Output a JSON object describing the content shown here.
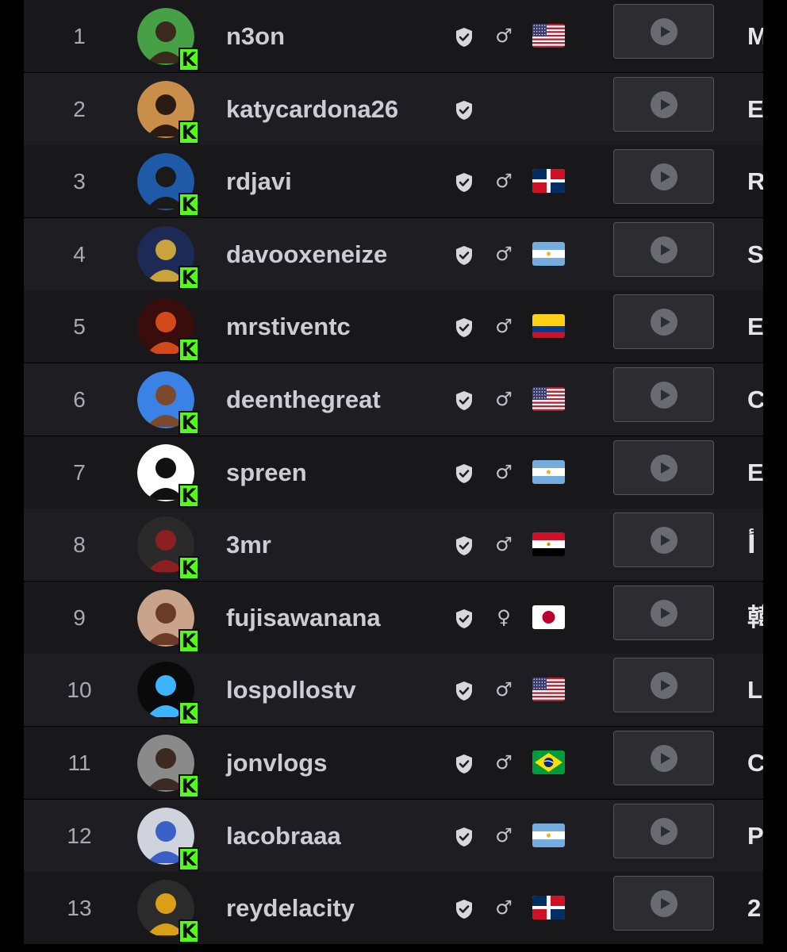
{
  "colors": {
    "kick_green": "#53fc18",
    "row_dark": "#18181b",
    "row_light": "#1e1e22",
    "text_primary": "#ccccd2",
    "text_muted": "#a9a9b0"
  },
  "icons": {
    "verified": "shield-check-icon",
    "male": "male-icon",
    "female": "female-icon",
    "play": "play-icon",
    "kick_badge": "kick-logo-icon"
  },
  "streamers": [
    {
      "rank": "1",
      "username": "n3on",
      "gender": "♂",
      "country": "US",
      "category_initial": "M"
    },
    {
      "rank": "2",
      "username": "katycardona26",
      "gender": "",
      "country": "",
      "category_initial": "E"
    },
    {
      "rank": "3",
      "username": "rdjavi",
      "gender": "♂",
      "country": "DO",
      "category_initial": "R"
    },
    {
      "rank": "4",
      "username": "davooxeneize",
      "gender": "♂",
      "country": "AR",
      "category_initial": "S"
    },
    {
      "rank": "5",
      "username": "mrstiventc",
      "gender": "♂",
      "country": "CO",
      "category_initial": "E"
    },
    {
      "rank": "6",
      "username": "deenthegreat",
      "gender": "♂",
      "country": "US",
      "category_initial": "C"
    },
    {
      "rank": "7",
      "username": "spreen",
      "gender": "♂",
      "country": "AR",
      "category_initial": "E"
    },
    {
      "rank": "8",
      "username": "3mr",
      "gender": "♂",
      "country": "EG",
      "category_initial": "أ"
    },
    {
      "rank": "9",
      "username": "fujisawanana",
      "gender": "♀",
      "country": "JP",
      "category_initial": "韓"
    },
    {
      "rank": "10",
      "username": "lospollostv",
      "gender": "♂",
      "country": "US",
      "category_initial": "L"
    },
    {
      "rank": "11",
      "username": "jonvlogs",
      "gender": "♂",
      "country": "BR",
      "category_initial": "C"
    },
    {
      "rank": "12",
      "username": "lacobraaa",
      "gender": "♂",
      "country": "AR",
      "category_initial": "P"
    },
    {
      "rank": "13",
      "username": "reydelacity",
      "gender": "♂",
      "country": "DO",
      "category_initial": "2"
    }
  ],
  "kick_badge_letter": "K"
}
